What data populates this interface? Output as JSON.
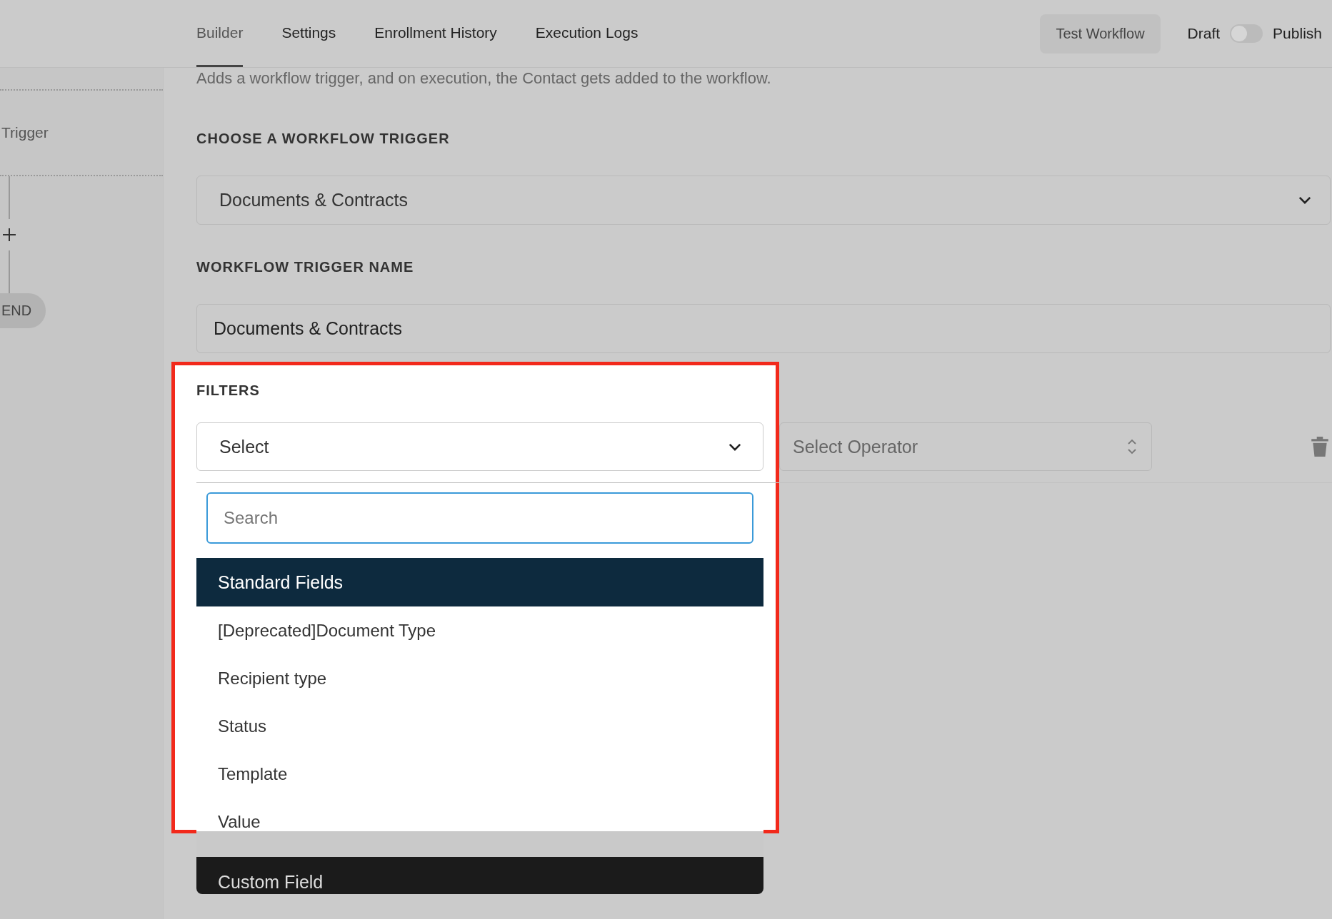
{
  "tabs": [
    {
      "label": "Builder",
      "selected": true
    },
    {
      "label": "Settings",
      "selected": false
    },
    {
      "label": "Enrollment History",
      "selected": false
    },
    {
      "label": "Execution Logs",
      "selected": false
    }
  ],
  "test_button": "Test Workflow",
  "publish_toggle": {
    "off_label": "Draft",
    "on_label": "Publish",
    "on": false
  },
  "sidebar": {
    "node_label": "Trigger",
    "end_label": "END"
  },
  "description": "Adds a workflow trigger, and on execution, the Contact gets added to the workflow.",
  "trigger_section": {
    "label": "CHOOSE A WORKFLOW TRIGGER",
    "value": "Documents & Contracts"
  },
  "name_section": {
    "label": "WORKFLOW TRIGGER NAME",
    "value": "Documents & Contracts"
  },
  "filters": {
    "label": "FILTERS",
    "field_select": "Select",
    "operator_placeholder": "Select Operator",
    "search_placeholder": "Search",
    "groups": [
      {
        "title": "Standard Fields",
        "kind": "standard",
        "options": [
          "[Deprecated]Document Type",
          "Recipient type",
          "Status",
          "Template",
          "Value"
        ]
      },
      {
        "title": "Custom Field",
        "kind": "custom"
      }
    ]
  }
}
